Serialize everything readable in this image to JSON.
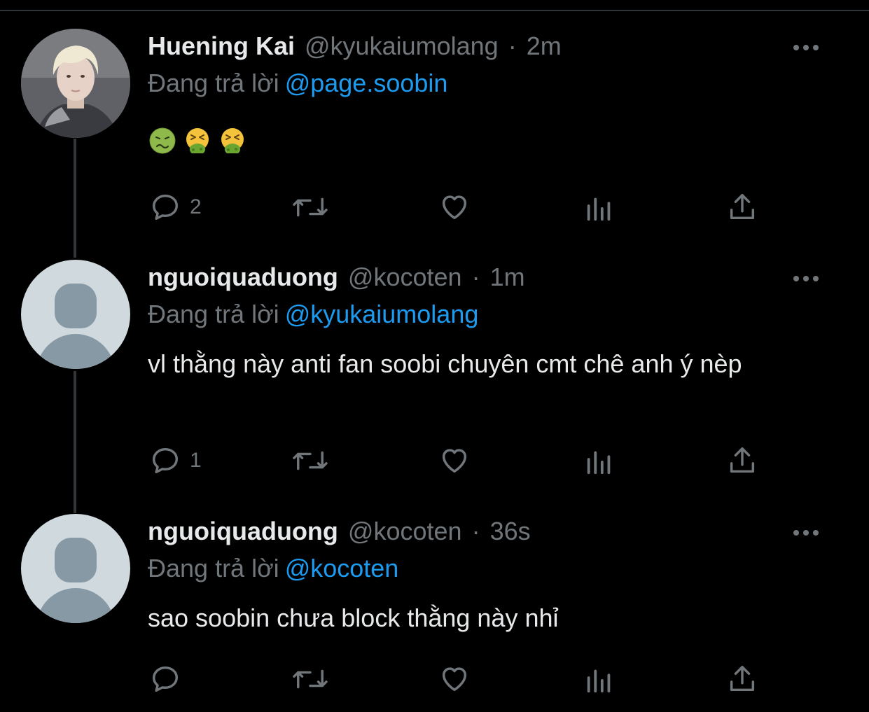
{
  "tweets": [
    {
      "display_name": "Huening Kai",
      "handle": "@kyukaiumolang",
      "separator": "·",
      "time": "2m",
      "replying_prefix": "Đang trả lời",
      "replying_to": "@page.soobin",
      "emojis": [
        "nauseated-face",
        "vomiting-face",
        "vomiting-face"
      ],
      "reply_count": "2"
    },
    {
      "display_name": "nguoiquaduong",
      "handle": "@kocoten",
      "separator": "·",
      "time": "1m",
      "replying_prefix": "Đang trả lời",
      "replying_to": "@kyukaiumolang",
      "text": "vl thằng này anti fan soobi chuyên cmt chê anh ý nèp",
      "reply_count": "1"
    },
    {
      "display_name": "nguoiquaduong",
      "handle": "@kocoten",
      "separator": "·",
      "time": "36s",
      "replying_prefix": "Đang trả lời",
      "replying_to": "@kocoten",
      "text": "sao soobin chưa block thằng này nhỉ",
      "reply_count": ""
    }
  ],
  "colors": {
    "background": "#000000",
    "text": "#e7e9ea",
    "secondary": "#71767b",
    "accent": "#1d9bf0",
    "thread_line": "#333639"
  }
}
